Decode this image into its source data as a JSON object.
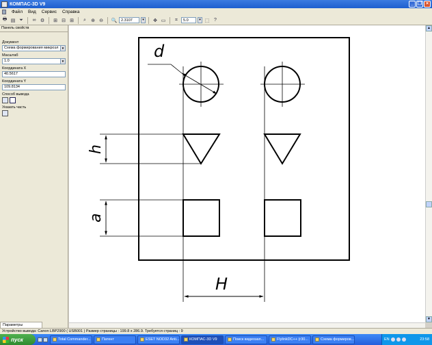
{
  "window": {
    "title": "КОМПАС-3D V9",
    "minimize_icon": "minimize-icon",
    "maximize_icon": "restore-icon",
    "close_icon": "close-icon"
  },
  "menu": {
    "items": [
      "Файл",
      "Вид",
      "Сервис",
      "Справка"
    ]
  },
  "toolbar": {
    "zoom_value": "2.3107",
    "step_value": "5.0"
  },
  "panel": {
    "title": "Панель свойств",
    "document_label": "Документ",
    "document_value": "Схема формирования микроэл",
    "scale_label": "Масштаб",
    "scale_value": "1.0",
    "coord_x_label": "Координата X",
    "coord_x_value": "40.5617",
    "coord_y_label": "Координата Y",
    "coord_y_value": "109.8134",
    "output_label": "Способ вывода",
    "part_label": "Указать часть",
    "tab_label": "Параметры просмотра"
  },
  "drawing": {
    "label_d": "d",
    "label_h": "h",
    "label_a": "a",
    "label_H": "H"
  },
  "status": {
    "text": "Устройство вывода: Canon LBP2900 ( USB001 )  Размер страницы : 199.8 x 286.9.  Требуется страниц : 9"
  },
  "taskbar": {
    "start_label": "пуск",
    "tasks": [
      "Total Commander...",
      "Патент",
      "ESET NOD32 Anti...",
      "КОМПАС-3D V9",
      "Поиск видеозап...",
      "FlylinkDC++ (r30...",
      "Схема формиров..."
    ],
    "lang": "EN",
    "clock": "23:58"
  }
}
